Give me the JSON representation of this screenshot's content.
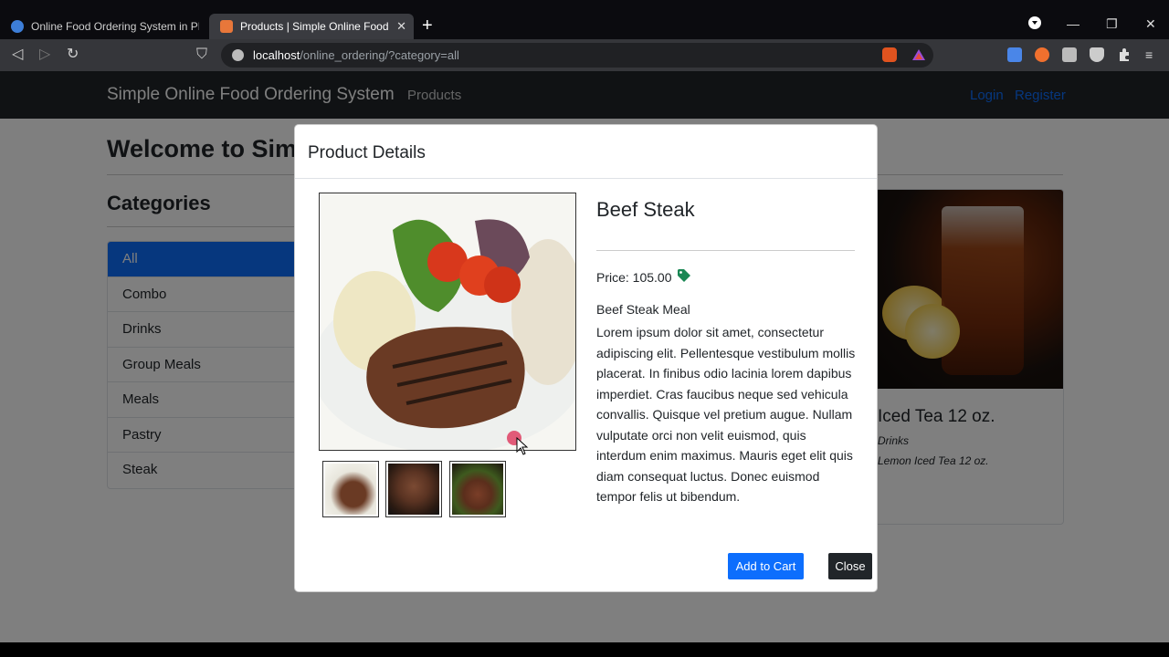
{
  "browser": {
    "tabs": [
      {
        "title": "Online Food Ordering System in PHP a",
        "close": ""
      },
      {
        "title": "Products | Simple Online Food Or",
        "close": "✕"
      }
    ],
    "new_tab": "+",
    "address": {
      "host": "localhost",
      "path": "/online_ordering/?category=all"
    },
    "window_controls": [
      "—",
      "❐",
      "✕"
    ],
    "nav": {
      "back": "◁",
      "forward": "▷",
      "reload": "↻",
      "bookmark": "⛉"
    }
  },
  "site": {
    "brand": "Simple Online Food Ordering System",
    "nav_products": "Products",
    "nav_login": "Login",
    "nav_register": "Register",
    "welcome": "Welcome to Simp"
  },
  "categories": {
    "title": "Categories",
    "items": [
      "All",
      "Combo",
      "Drinks",
      "Group Meals",
      "Meals",
      "Pastry",
      "Steak"
    ],
    "active": "All"
  },
  "background_product": {
    "name": "Iced Tea 12 oz.",
    "category": "Drinks",
    "description": "Lemon Iced Tea 12 oz."
  },
  "modal": {
    "title": "Product Details",
    "product_name": "Beef Steak",
    "price_label": "Price: 105.00",
    "price_icon": "tag-icon",
    "desc_title": "Beef Steak Meal",
    "desc_body": "Lorem ipsum dolor sit amet, consectetur adipiscing elit. Pellentesque vestibulum mollis placerat. In finibus odio lacinia lorem dapibus imperdiet. Cras faucibus neque sed vehicula convallis. Quisque vel pretium augue. Nullam vulputate orci non velit euismod, quis interdum enim maximus. Mauris eget elit quis diam consequat luctus. Donec euismod tempor felis ut bibendum.",
    "btn_add_to_cart": "Add to Cart",
    "btn_close": "Close"
  },
  "colors": {
    "primary": "#0d6efd",
    "dark": "#212529",
    "tag_green": "#1a8754"
  }
}
